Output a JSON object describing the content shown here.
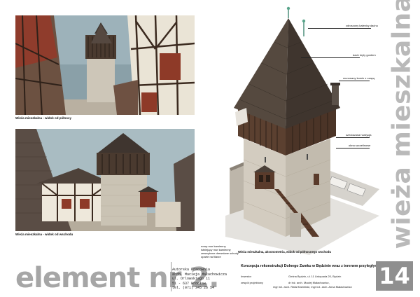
{
  "sheet": {
    "vertical_title": "wieża mieszkalna",
    "element_title": "element nr 2.",
    "sheet_number": "14"
  },
  "renders": {
    "north": {
      "caption": "Wieża mieszkalna - widok od północy"
    },
    "east": {
      "caption": "Wieża mieszkalna - widok od wschodu"
    },
    "axonometric": {
      "caption": "Wieża mieszkalna, aksonometria, widok od  północnego wschodu"
    }
  },
  "callouts_right": [
    "zdroszony kalenicy dachu",
    "dach kryty gontem",
    "murowany komin z czapą",
    "szedowana hurdycja",
    "okna szczelinowe"
  ],
  "callouts_left": [
    "nowy mur kamienny",
    "istniejący mur kamienny",
    "zewnętrzne drewniane schody",
    "oparte na filarze"
  ],
  "studio": {
    "line1": "Autorska Pracownia",
    "line2": "arch. Macieja Małachowicza",
    "line3": "ul. Orlowskiego 11",
    "line4": "51 - 637   Wrocław",
    "line5": "tel. (071) 345 26 54"
  },
  "project": {
    "title": "Koncepcja rekonstrukcji Dolnego Zamku w Będzinie wraz z terenem przyległym",
    "investor_label": "Inwestor",
    "investor_value": "Gmina Będzin, ul. 11 Listopada 20, Będzin",
    "team_label": "zespół projektowy",
    "team_value_1": "dr inż. arch. Maciej Małachowicz,",
    "team_value_2": "mgr inż. arch. Rafał Kamiński, mgr inż. arch. Anna Małachowicz"
  },
  "colors": {
    "title_gray": "#a6a6a6",
    "number_box": "#8f8f8f",
    "roof": "#4a4038",
    "stone": "#cfc9bd",
    "timber": "#5a3f2e"
  }
}
